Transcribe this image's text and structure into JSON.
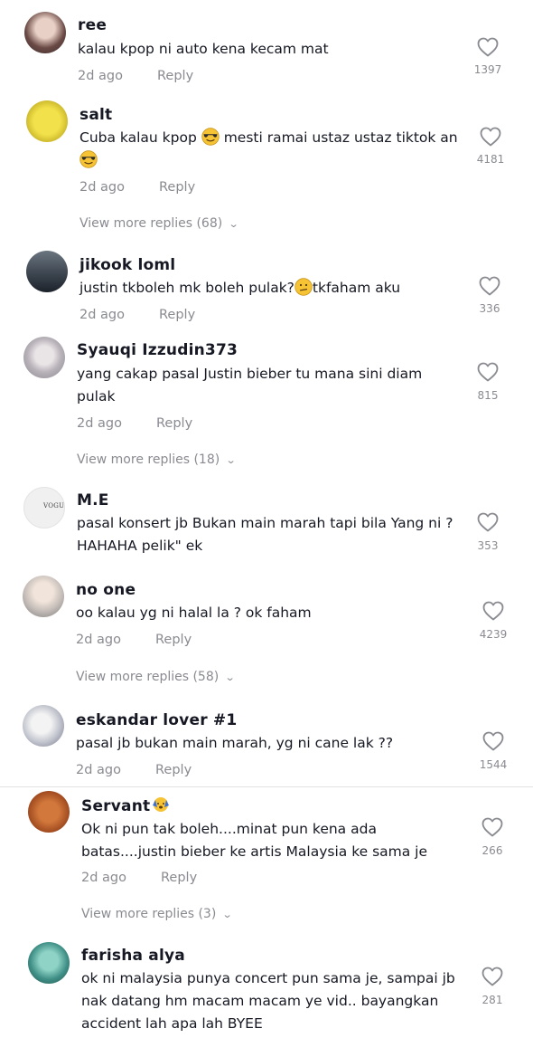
{
  "comments": [
    {
      "username": "ree",
      "text": "kalau kpop ni auto kena kecam mat",
      "time": "2d ago",
      "reply": "Reply",
      "likes": "1397"
    },
    {
      "username": "salt",
      "text_a": "Cuba kalau kpop",
      "text_b": "mesti ramai ustaz ustaz tiktok an",
      "time": "2d ago",
      "reply": "Reply",
      "likes": "4181",
      "more": "View more replies (68)",
      "emoji": "smiling-face-with-sunglasses"
    },
    {
      "username": "jikook loml",
      "text_a": "justin tkboleh mk boleh pulak?",
      "text_b": "tkfaham aku",
      "time": "2d ago",
      "reply": "Reply",
      "likes": "336",
      "emoji": "confused-face"
    },
    {
      "username": "Syauqi Izzudin373",
      "line1": "yang cakap pasal Justin bieber tu mana sini diam",
      "line2": "pulak",
      "time": "2d ago",
      "reply": "Reply",
      "likes": "815",
      "more": "View more replies (18)"
    },
    {
      "username": "M.E",
      "line1": "pasal konsert jb Bukan main marah tapi bila Yang ni ?",
      "line2": "HAHAHA pelik\" ek",
      "likes": "353",
      "avatar_text": "VOGUE"
    },
    {
      "username": "no one",
      "text": "oo kalau yg ni halal la ? ok faham",
      "time": "2d ago",
      "reply": "Reply",
      "likes": "4239",
      "more": "View more replies (58)"
    },
    {
      "username": "eskandar lover #1",
      "text": "pasal jb bukan main marah, yg ni cane lak ??",
      "time": "2d ago",
      "reply": "Reply",
      "likes": "1544"
    },
    {
      "username": "Servant",
      "line1": "Ok ni pun tak boleh....minat pun kena ada",
      "line2": "batas....justin bieber ke artis Malaysia ke sama je",
      "time": "2d ago",
      "reply": "Reply",
      "likes": "266",
      "more": "View more replies (3)",
      "emoji": "face-with-hands"
    },
    {
      "username": "farisha alya",
      "line1": "ok ni malaysia punya concert pun sama je, sampai jb",
      "line2": "nak datang hm macam macam ye vid.. bayangkan",
      "line3": "accident lah apa lah BYEE",
      "likes": "281"
    }
  ],
  "colors": {
    "text": "#161823",
    "muted": "#8a8b91",
    "divider": "#e3e3e4",
    "heart": "#8a8b91"
  },
  "icons": {
    "like": "heart-outline-icon",
    "expand": "chevron-down-icon"
  }
}
